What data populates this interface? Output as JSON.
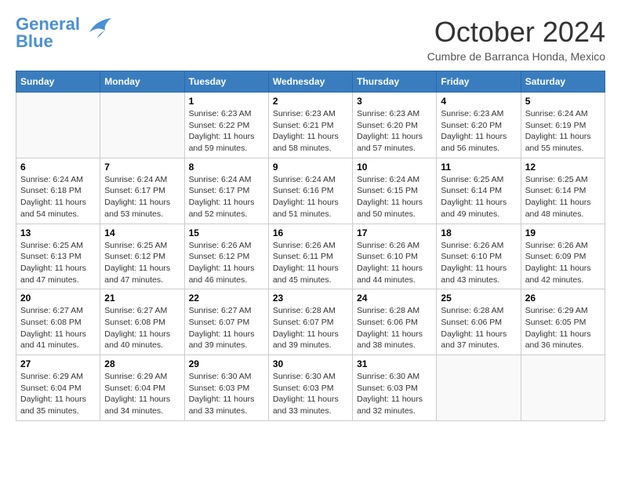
{
  "header": {
    "logo_line1": "General",
    "logo_line2": "Blue",
    "month_title": "October 2024",
    "location": "Cumbre de Barranca Honda, Mexico"
  },
  "days_of_week": [
    "Sunday",
    "Monday",
    "Tuesday",
    "Wednesday",
    "Thursday",
    "Friday",
    "Saturday"
  ],
  "weeks": [
    [
      {
        "day": "",
        "info": ""
      },
      {
        "day": "",
        "info": ""
      },
      {
        "day": "1",
        "info": "Sunrise: 6:23 AM\nSunset: 6:22 PM\nDaylight: 11 hours and 59 minutes."
      },
      {
        "day": "2",
        "info": "Sunrise: 6:23 AM\nSunset: 6:21 PM\nDaylight: 11 hours and 58 minutes."
      },
      {
        "day": "3",
        "info": "Sunrise: 6:23 AM\nSunset: 6:20 PM\nDaylight: 11 hours and 57 minutes."
      },
      {
        "day": "4",
        "info": "Sunrise: 6:23 AM\nSunset: 6:20 PM\nDaylight: 11 hours and 56 minutes."
      },
      {
        "day": "5",
        "info": "Sunrise: 6:24 AM\nSunset: 6:19 PM\nDaylight: 11 hours and 55 minutes."
      }
    ],
    [
      {
        "day": "6",
        "info": "Sunrise: 6:24 AM\nSunset: 6:18 PM\nDaylight: 11 hours and 54 minutes."
      },
      {
        "day": "7",
        "info": "Sunrise: 6:24 AM\nSunset: 6:17 PM\nDaylight: 11 hours and 53 minutes."
      },
      {
        "day": "8",
        "info": "Sunrise: 6:24 AM\nSunset: 6:17 PM\nDaylight: 11 hours and 52 minutes."
      },
      {
        "day": "9",
        "info": "Sunrise: 6:24 AM\nSunset: 6:16 PM\nDaylight: 11 hours and 51 minutes."
      },
      {
        "day": "10",
        "info": "Sunrise: 6:24 AM\nSunset: 6:15 PM\nDaylight: 11 hours and 50 minutes."
      },
      {
        "day": "11",
        "info": "Sunrise: 6:25 AM\nSunset: 6:14 PM\nDaylight: 11 hours and 49 minutes."
      },
      {
        "day": "12",
        "info": "Sunrise: 6:25 AM\nSunset: 6:14 PM\nDaylight: 11 hours and 48 minutes."
      }
    ],
    [
      {
        "day": "13",
        "info": "Sunrise: 6:25 AM\nSunset: 6:13 PM\nDaylight: 11 hours and 47 minutes."
      },
      {
        "day": "14",
        "info": "Sunrise: 6:25 AM\nSunset: 6:12 PM\nDaylight: 11 hours and 47 minutes."
      },
      {
        "day": "15",
        "info": "Sunrise: 6:26 AM\nSunset: 6:12 PM\nDaylight: 11 hours and 46 minutes."
      },
      {
        "day": "16",
        "info": "Sunrise: 6:26 AM\nSunset: 6:11 PM\nDaylight: 11 hours and 45 minutes."
      },
      {
        "day": "17",
        "info": "Sunrise: 6:26 AM\nSunset: 6:10 PM\nDaylight: 11 hours and 44 minutes."
      },
      {
        "day": "18",
        "info": "Sunrise: 6:26 AM\nSunset: 6:10 PM\nDaylight: 11 hours and 43 minutes."
      },
      {
        "day": "19",
        "info": "Sunrise: 6:26 AM\nSunset: 6:09 PM\nDaylight: 11 hours and 42 minutes."
      }
    ],
    [
      {
        "day": "20",
        "info": "Sunrise: 6:27 AM\nSunset: 6:08 PM\nDaylight: 11 hours and 41 minutes."
      },
      {
        "day": "21",
        "info": "Sunrise: 6:27 AM\nSunset: 6:08 PM\nDaylight: 11 hours and 40 minutes."
      },
      {
        "day": "22",
        "info": "Sunrise: 6:27 AM\nSunset: 6:07 PM\nDaylight: 11 hours and 39 minutes."
      },
      {
        "day": "23",
        "info": "Sunrise: 6:28 AM\nSunset: 6:07 PM\nDaylight: 11 hours and 39 minutes."
      },
      {
        "day": "24",
        "info": "Sunrise: 6:28 AM\nSunset: 6:06 PM\nDaylight: 11 hours and 38 minutes."
      },
      {
        "day": "25",
        "info": "Sunrise: 6:28 AM\nSunset: 6:06 PM\nDaylight: 11 hours and 37 minutes."
      },
      {
        "day": "26",
        "info": "Sunrise: 6:29 AM\nSunset: 6:05 PM\nDaylight: 11 hours and 36 minutes."
      }
    ],
    [
      {
        "day": "27",
        "info": "Sunrise: 6:29 AM\nSunset: 6:04 PM\nDaylight: 11 hours and 35 minutes."
      },
      {
        "day": "28",
        "info": "Sunrise: 6:29 AM\nSunset: 6:04 PM\nDaylight: 11 hours and 34 minutes."
      },
      {
        "day": "29",
        "info": "Sunrise: 6:30 AM\nSunset: 6:03 PM\nDaylight: 11 hours and 33 minutes."
      },
      {
        "day": "30",
        "info": "Sunrise: 6:30 AM\nSunset: 6:03 PM\nDaylight: 11 hours and 33 minutes."
      },
      {
        "day": "31",
        "info": "Sunrise: 6:30 AM\nSunset: 6:03 PM\nDaylight: 11 hours and 32 minutes."
      },
      {
        "day": "",
        "info": ""
      },
      {
        "day": "",
        "info": ""
      }
    ]
  ]
}
